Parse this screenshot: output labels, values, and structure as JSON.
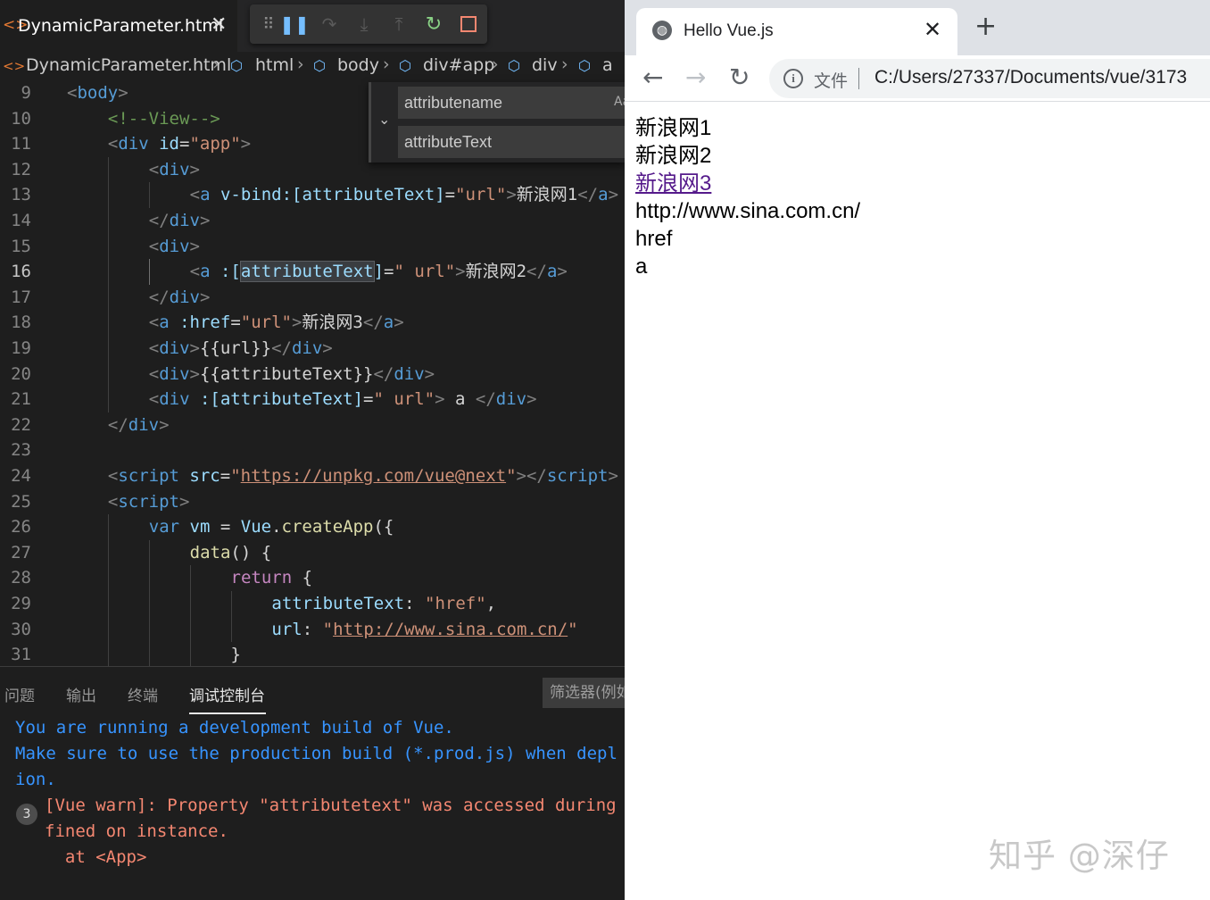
{
  "editor_tab": {
    "title": "DynamicParameter.html",
    "close": "✕"
  },
  "debug_toolbar": {
    "icons": [
      "drag-grip-icon",
      "pause-icon",
      "step-over-icon",
      "step-into-icon",
      "step-out-icon",
      "restart-icon",
      "stop-icon"
    ]
  },
  "breadcrumb": [
    "DynamicParameter.html",
    "html",
    "body",
    "div#app",
    "div",
    "a"
  ],
  "find_widget": {
    "find_value": "attributename",
    "replace_value": "attributeText",
    "match_case": "Aa"
  },
  "code_lines": [
    {
      "n": "9",
      "tokens": [
        [
          "t-br",
          "<"
        ],
        [
          "t-tag",
          "body"
        ],
        [
          "t-br",
          ">"
        ]
      ]
    },
    {
      "n": "10",
      "tokens": [
        [
          "t-com",
          "<!--View-->"
        ]
      ]
    },
    {
      "n": "11",
      "tokens": [
        [
          "t-br",
          "<"
        ],
        [
          "t-tag",
          "div"
        ],
        [
          "t-txt",
          " "
        ],
        [
          "t-attr",
          "id"
        ],
        [
          "t-txt",
          "="
        ],
        [
          "t-str",
          "\"app\""
        ],
        [
          "t-br",
          ">"
        ]
      ]
    },
    {
      "n": "12",
      "tokens": [
        [
          "t-br",
          "<"
        ],
        [
          "t-tag",
          "div"
        ],
        [
          "t-br",
          ">"
        ]
      ]
    },
    {
      "n": "13",
      "tokens": [
        [
          "t-br",
          "<"
        ],
        [
          "t-tag",
          "a"
        ],
        [
          "t-txt",
          " "
        ],
        [
          "t-attr",
          "v-bind:[attributeText]"
        ],
        [
          "t-txt",
          "="
        ],
        [
          "t-str",
          "\"url\""
        ],
        [
          "t-br",
          ">"
        ],
        [
          "t-txt",
          "新浪网1"
        ],
        [
          "t-br",
          "</"
        ],
        [
          "t-tag",
          "a"
        ],
        [
          "t-br",
          ">"
        ]
      ]
    },
    {
      "n": "14",
      "tokens": [
        [
          "t-br",
          "</"
        ],
        [
          "t-tag",
          "div"
        ],
        [
          "t-br",
          ">"
        ]
      ]
    },
    {
      "n": "15",
      "tokens": [
        [
          "t-br",
          "<"
        ],
        [
          "t-tag",
          "div"
        ],
        [
          "t-br",
          ">"
        ]
      ]
    },
    {
      "n": "16",
      "tokens": [
        [
          "t-br",
          "<"
        ],
        [
          "t-tag",
          "a"
        ],
        [
          "t-txt",
          " "
        ],
        [
          "t-attr",
          ":["
        ],
        [
          "t-attr t-hl",
          "attributeText"
        ],
        [
          "t-attr",
          "]"
        ],
        [
          "t-txt",
          "="
        ],
        [
          "t-str",
          "\" url\""
        ],
        [
          "t-br",
          ">"
        ],
        [
          "t-txt",
          "新浪网2"
        ],
        [
          "t-br",
          "</"
        ],
        [
          "t-tag",
          "a"
        ],
        [
          "t-br",
          ">"
        ]
      ]
    },
    {
      "n": "17",
      "tokens": [
        [
          "t-br",
          "</"
        ],
        [
          "t-tag",
          "div"
        ],
        [
          "t-br",
          ">"
        ]
      ]
    },
    {
      "n": "18",
      "tokens": [
        [
          "t-br",
          "<"
        ],
        [
          "t-tag",
          "a"
        ],
        [
          "t-txt",
          " "
        ],
        [
          "t-attr",
          ":href"
        ],
        [
          "t-txt",
          "="
        ],
        [
          "t-str",
          "\"url\""
        ],
        [
          "t-br",
          ">"
        ],
        [
          "t-txt",
          "新浪网3"
        ],
        [
          "t-br",
          "</"
        ],
        [
          "t-tag",
          "a"
        ],
        [
          "t-br",
          ">"
        ]
      ]
    },
    {
      "n": "19",
      "tokens": [
        [
          "t-br",
          "<"
        ],
        [
          "t-tag",
          "div"
        ],
        [
          "t-br",
          ">"
        ],
        [
          "t-txt",
          "{{url}}"
        ],
        [
          "t-br",
          "</"
        ],
        [
          "t-tag",
          "div"
        ],
        [
          "t-br",
          ">"
        ]
      ]
    },
    {
      "n": "20",
      "tokens": [
        [
          "t-br",
          "<"
        ],
        [
          "t-tag",
          "div"
        ],
        [
          "t-br",
          ">"
        ],
        [
          "t-txt",
          "{{attributeText}}"
        ],
        [
          "t-br",
          "</"
        ],
        [
          "t-tag",
          "div"
        ],
        [
          "t-br",
          ">"
        ]
      ]
    },
    {
      "n": "21",
      "tokens": [
        [
          "t-br",
          "<"
        ],
        [
          "t-tag",
          "div"
        ],
        [
          "t-txt",
          " "
        ],
        [
          "t-attr",
          ":[attributeText]"
        ],
        [
          "t-txt",
          "="
        ],
        [
          "t-str",
          "\" url\""
        ],
        [
          "t-br",
          ">"
        ],
        [
          "t-txt",
          " a "
        ],
        [
          "t-br",
          "</"
        ],
        [
          "t-tag",
          "div"
        ],
        [
          "t-br",
          ">"
        ]
      ]
    },
    {
      "n": "22",
      "tokens": [
        [
          "t-br",
          "</"
        ],
        [
          "t-tag",
          "div"
        ],
        [
          "t-br",
          ">"
        ]
      ]
    },
    {
      "n": "23",
      "tokens": []
    },
    {
      "n": "24",
      "tokens": [
        [
          "t-br",
          "<"
        ],
        [
          "t-tag",
          "script"
        ],
        [
          "t-txt",
          " "
        ],
        [
          "t-attr",
          "src"
        ],
        [
          "t-txt",
          "="
        ],
        [
          "t-str",
          "\""
        ],
        [
          "t-link",
          "https://unpkg.com/vue@next"
        ],
        [
          "t-str",
          "\""
        ],
        [
          "t-br",
          "></"
        ],
        [
          "t-tag",
          "script"
        ],
        [
          "t-br",
          ">"
        ]
      ]
    },
    {
      "n": "25",
      "tokens": [
        [
          "t-br",
          "<"
        ],
        [
          "t-tag",
          "script"
        ],
        [
          "t-br",
          ">"
        ]
      ]
    },
    {
      "n": "26",
      "tokens": [
        [
          "t-kw",
          "var"
        ],
        [
          "t-txt",
          " "
        ],
        [
          "t-var",
          "vm"
        ],
        [
          "t-txt",
          " = "
        ],
        [
          "t-var",
          "Vue"
        ],
        [
          "t-txt",
          "."
        ],
        [
          "t-fn",
          "createApp"
        ],
        [
          "t-txt",
          "({"
        ]
      ]
    },
    {
      "n": "27",
      "tokens": [
        [
          "t-fn",
          "data"
        ],
        [
          "t-txt",
          "() {"
        ]
      ]
    },
    {
      "n": "28",
      "tokens": [
        [
          "t-ctl",
          "return"
        ],
        [
          "t-txt",
          " {"
        ]
      ]
    },
    {
      "n": "29",
      "tokens": [
        [
          "t-var",
          "attributeText"
        ],
        [
          "t-txt",
          ": "
        ],
        [
          "t-str",
          "\"href\""
        ],
        [
          "t-txt",
          ","
        ]
      ]
    },
    {
      "n": "30",
      "tokens": [
        [
          "t-var",
          "url"
        ],
        [
          "t-txt",
          ": "
        ],
        [
          "t-str",
          "\""
        ],
        [
          "t-link",
          "http://www.sina.com.cn/"
        ],
        [
          "t-str",
          "\""
        ]
      ]
    },
    {
      "n": "31",
      "tokens": [
        [
          "t-txt",
          "}"
        ]
      ]
    }
  ],
  "active_line": "16",
  "panel": {
    "tabs": [
      "问题",
      "输出",
      "终端",
      "调试控制台"
    ],
    "active_tab": "调试控制台",
    "filter_placeholder": "筛选器(例如",
    "console": {
      "info_1": "You are running a development build of Vue.",
      "info_2": "Make sure to use the production build (*.prod.js) when depl",
      "info_3": "ion.",
      "warn_count": "3",
      "warn_1": "[Vue warn]: Property \"attributetext\" was accessed during",
      "warn_2": "fined on instance.",
      "warn_3": "  at <App>"
    }
  },
  "browser": {
    "tab_title": "Hello Vue.js",
    "tab_close": "✕",
    "new_tab": "+",
    "address_label": "文件",
    "address_url": "C:/Users/27337/Documents/vue/3173",
    "page_lines": [
      {
        "text": "新浪网1",
        "link": false
      },
      {
        "text": "新浪网2",
        "link": false
      },
      {
        "text": "新浪网3",
        "link": true
      },
      {
        "text": "http://www.sina.com.cn/",
        "link": false
      },
      {
        "text": "href",
        "link": false
      },
      {
        "text": "a",
        "link": false
      }
    ]
  },
  "watermark": "知乎 @深仔"
}
